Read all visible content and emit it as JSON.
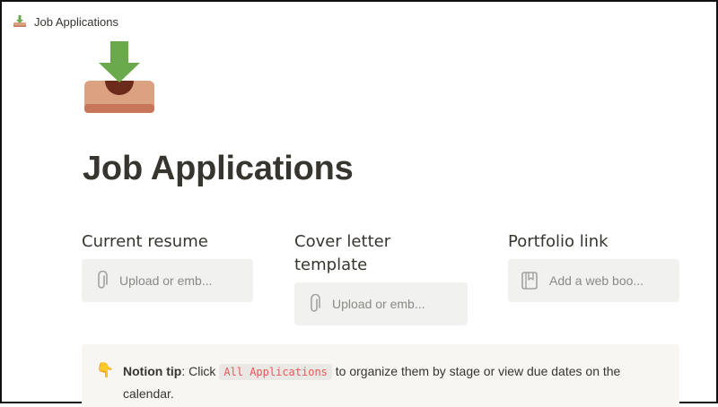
{
  "window": {
    "title": "Job Applications"
  },
  "page": {
    "title": "Job Applications",
    "icon": "inbox-download-icon"
  },
  "columns": [
    {
      "heading": "Current resume",
      "embed_placeholder": "Upload or emb...",
      "embed_icon": "paperclip-icon"
    },
    {
      "heading": "Cover letter template",
      "embed_placeholder": "Upload or emb...",
      "embed_icon": "paperclip-icon"
    },
    {
      "heading": "Portfolio link",
      "embed_placeholder": "Add a web boo...",
      "embed_icon": "bookmark-icon"
    }
  ],
  "callout": {
    "emoji": "👇",
    "label": "Notion tip",
    "text_before": ": Click ",
    "link": "All Applications",
    "text_after": " to organize them by stage or view due dates on the calendar."
  },
  "colors": {
    "text": "#37352f",
    "placeholder": "#8a8984",
    "embed_bg": "#f1f1ef",
    "callout_bg": "#f7f6f3",
    "code_text": "#eb5757"
  }
}
